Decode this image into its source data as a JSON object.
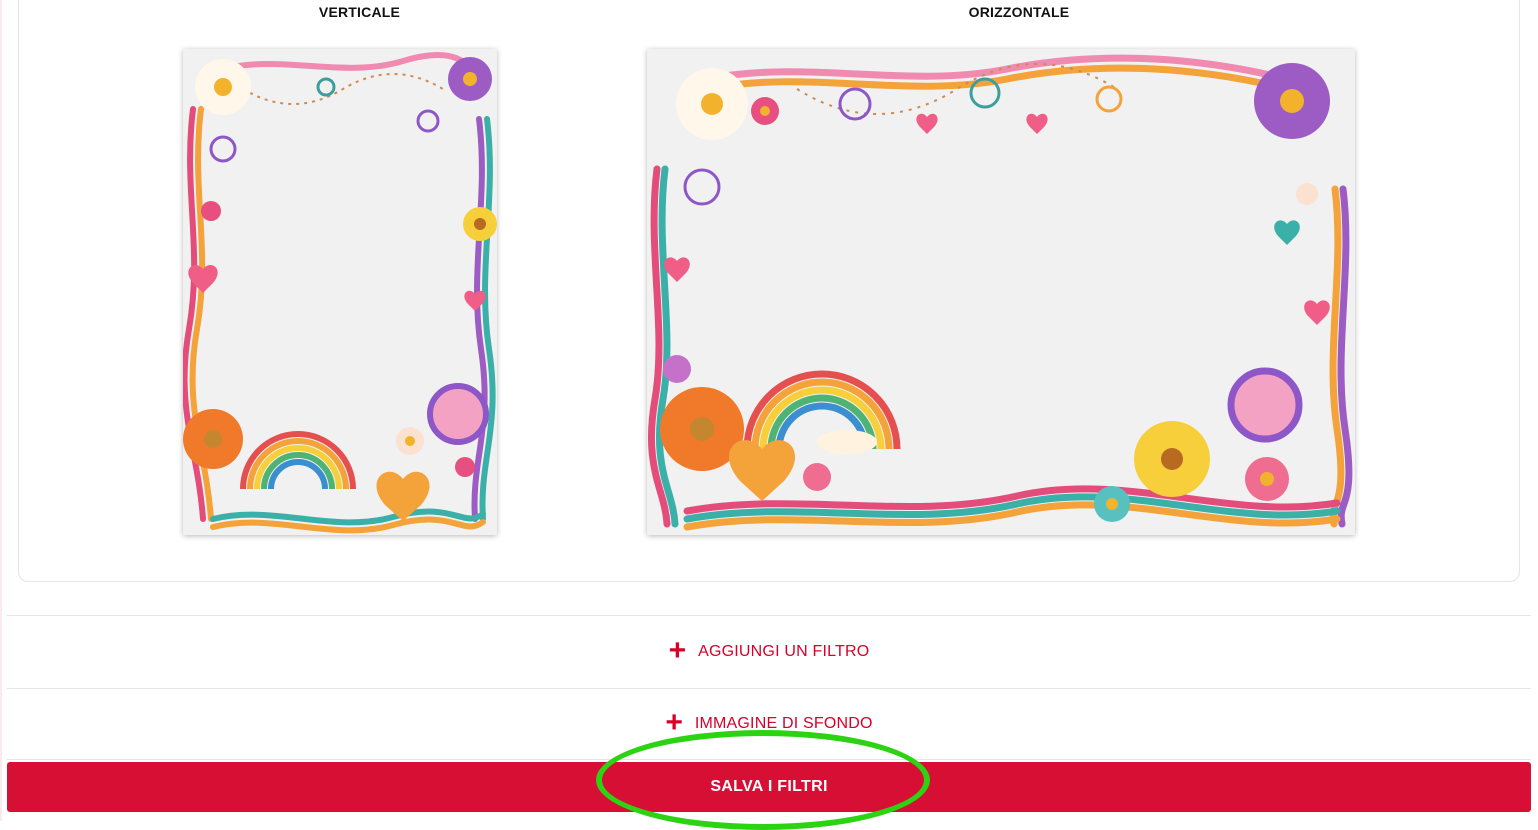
{
  "preview": {
    "vertical_label": "VERTICALE",
    "horizontal_label": "ORIZZONTALE"
  },
  "actions": {
    "add_filter_label": "AGGIUNGI UN FILTRO",
    "background_image_label": "IMMAGINE DI SFONDO",
    "save_filters_label": "SALVA I FILTRI"
  },
  "colors": {
    "accent": "#d70f35",
    "highlight": "#2bd312"
  },
  "icons": {
    "add": "plus-icon"
  }
}
